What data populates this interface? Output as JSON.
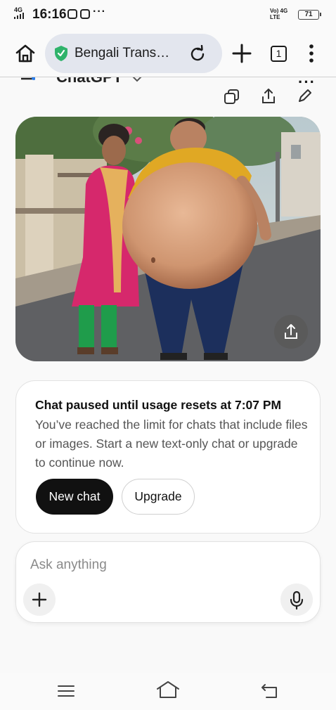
{
  "status_bar": {
    "signal": "4G",
    "time": "16:16",
    "more": "···",
    "network_1": "Vo) 4G",
    "network_2": "LTE",
    "battery": "71"
  },
  "browser": {
    "url": "Bengali Trans…",
    "tab_count": "1",
    "icons": [
      "home-icon",
      "shield-icon",
      "reload-icon",
      "plus-icon",
      "tabs-icon",
      "more-vert-icon"
    ]
  },
  "chat_header": {
    "title": "ChatGPT",
    "more": "···"
  },
  "paused": {
    "title": "Chat paused until usage resets at 7:07 PM",
    "body": "You’ve reached the limit for chats that include files or images. Start a new text-only chat or upgrade to continue now.",
    "new_chat_label": "New chat",
    "upgrade_label": "Upgrade"
  },
  "composer": {
    "placeholder": "Ask anything"
  },
  "colors": {
    "accent_green": "#2fb36b",
    "dark_button": "#111111",
    "url_pill": "#e3e6ee"
  }
}
